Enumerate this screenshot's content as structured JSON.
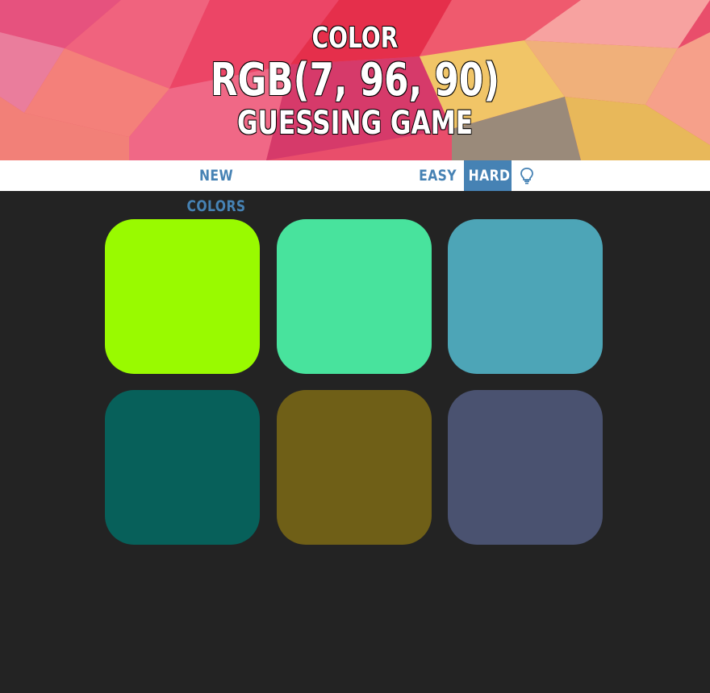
{
  "header": {
    "line1": "COLOR",
    "rgb_display": "RGB(7, 96, 90)",
    "line3": "GUESSING GAME"
  },
  "toolbar": {
    "new_colors_label": "NEW COLORS",
    "easy_label": "EASY",
    "hard_label": "HARD",
    "hint_icon": "lightbulb-icon",
    "selected_mode": "HARD",
    "message": ""
  },
  "colors": {
    "accent": "#4682b4",
    "background": "#232323",
    "stripe": "#ffffff"
  },
  "squares": [
    "#99fa00",
    "#48e39d",
    "#4da5b7",
    "#07605a",
    "#6f5f17",
    "#4a5270"
  ]
}
